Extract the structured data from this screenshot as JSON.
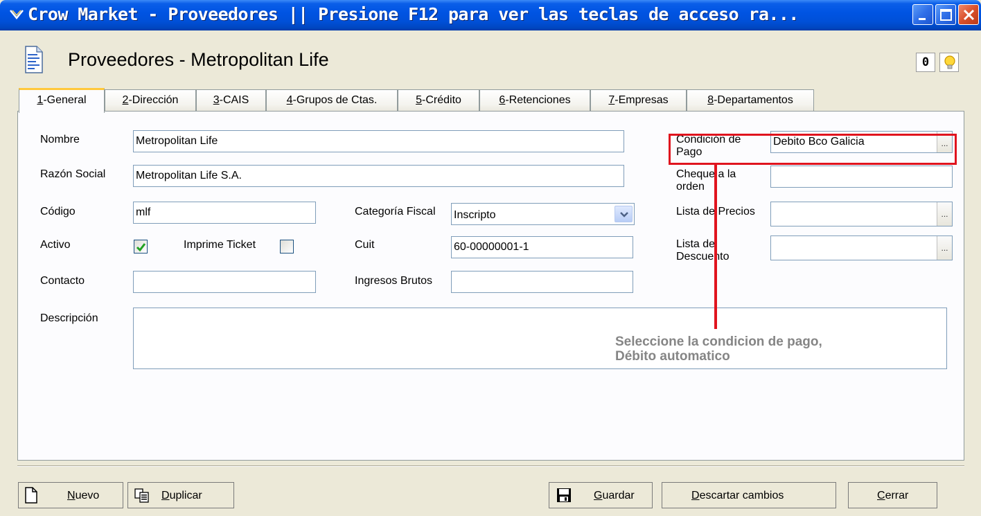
{
  "window": {
    "title": "Crow Market - Proveedores || Presione F12 para ver las teclas de acceso ra...",
    "controls": [
      "minimize",
      "maximize",
      "close"
    ]
  },
  "header": {
    "title": "Proveedores - Metropolitan Life",
    "icon": "document-icon",
    "buttons": [
      {
        "icon": "paperclip-icon",
        "glyph": "0"
      },
      {
        "icon": "lightbulb-icon"
      }
    ]
  },
  "tabs": [
    {
      "key": "1",
      "label": "-General",
      "active": true
    },
    {
      "key": "2",
      "label": "-Dirección"
    },
    {
      "key": "3",
      "label": "-CAIS"
    },
    {
      "key": "4",
      "label": "-Grupos de Ctas."
    },
    {
      "key": "5",
      "label": "-Crédito"
    },
    {
      "key": "6",
      "label": "-Retenciones"
    },
    {
      "key": "7",
      "label": "-Empresas"
    },
    {
      "key": "8",
      "label": "-Departamentos"
    }
  ],
  "form": {
    "nombre": {
      "label": "Nombre",
      "value": "Metropolitan Life"
    },
    "razon_social": {
      "label": "Razón Social",
      "value": "Metropolitan Life S.A."
    },
    "codigo": {
      "label": "Código",
      "value": "mlf"
    },
    "activo": {
      "label": "Activo",
      "checked": true
    },
    "imprime_ticket": {
      "label": "Imprime Ticket",
      "checked": false
    },
    "contacto": {
      "label": "Contacto",
      "value": ""
    },
    "categoria_fiscal": {
      "label": "Categoría Fiscal",
      "value": "Inscripto"
    },
    "cuit": {
      "label": "Cuit",
      "value": "60-00000001-1"
    },
    "ingresos_brutos": {
      "label": "Ingresos Brutos",
      "value": ""
    },
    "descripcion": {
      "label": "Descripción",
      "value": ""
    },
    "condicion_pago": {
      "label": "Condición de Pago",
      "value": "Debito Bco Galicia",
      "button": "..."
    },
    "cheque_orden": {
      "label": "Cheque a la orden",
      "value": ""
    },
    "lista_precios": {
      "label": "Lista de Precios",
      "value": "",
      "button": "..."
    },
    "lista_descuento": {
      "label": "Lista de Descuento",
      "value": "",
      "button": "..."
    }
  },
  "annotation": {
    "line1": "Seleccione la condicion de pago,",
    "line2": "Débito automatico",
    "color": "#e0141e"
  },
  "footer": {
    "nuevo": {
      "key": "N",
      "rest": "uevo"
    },
    "duplicar": {
      "key": "D",
      "rest": "uplicar"
    },
    "guardar": {
      "key": "G",
      "rest": "uardar"
    },
    "descartar": {
      "key": "D",
      "rest": "escartar cambios"
    },
    "cerrar": {
      "key": "C",
      "rest": "errar"
    }
  }
}
